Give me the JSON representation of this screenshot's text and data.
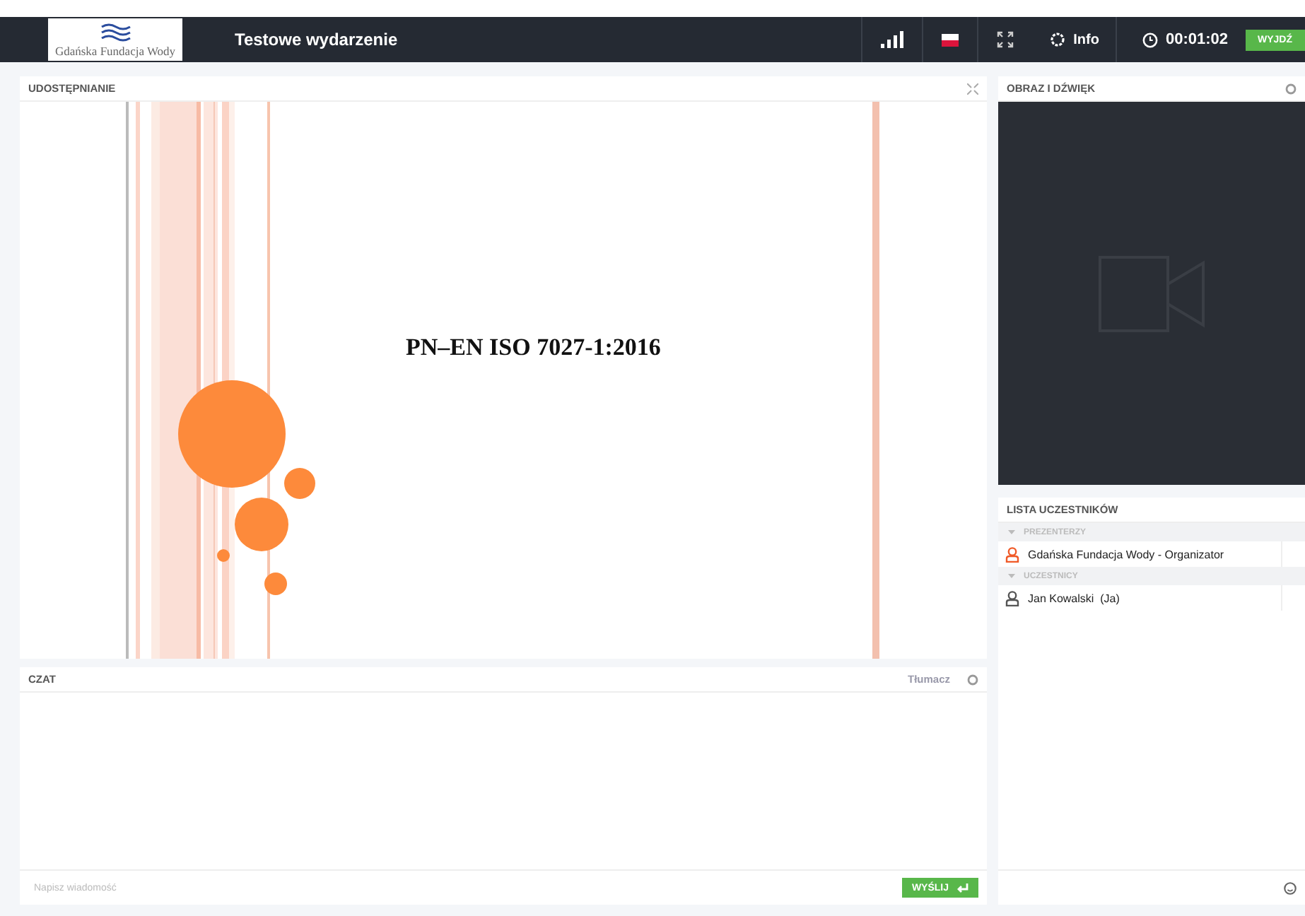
{
  "header": {
    "logo_text": "Gdańska Fundacja Wody",
    "title": "Testowe wydarzenie",
    "info_label": "Info",
    "timer": "00:01:02",
    "exit_button": "WYJDŹ"
  },
  "share_panel": {
    "title": "UDOSTĘPNIANIE",
    "slide_title": "PN–EN ISO 7027-1:2016"
  },
  "video_panel": {
    "title": "OBRAZ I DŹWIĘK"
  },
  "participants": {
    "title": "LISTA UCZESTNIKÓW",
    "groups": [
      {
        "label": "PREZENTERZY",
        "expanded": true,
        "people": [
          {
            "name": "Gdańska Fundacja Wody - Organizator",
            "kind": "presenter"
          }
        ]
      },
      {
        "label": "UCZESTNICY",
        "expanded": true,
        "people": [
          {
            "name": "Jan Kowalski  (Ja)",
            "kind": "attendee"
          }
        ]
      }
    ]
  },
  "chat": {
    "title": "CZAT",
    "translate_label": "Tłumacz",
    "placeholder": "Napisz wiadomość",
    "send_button": "WYŚLIJ"
  }
}
